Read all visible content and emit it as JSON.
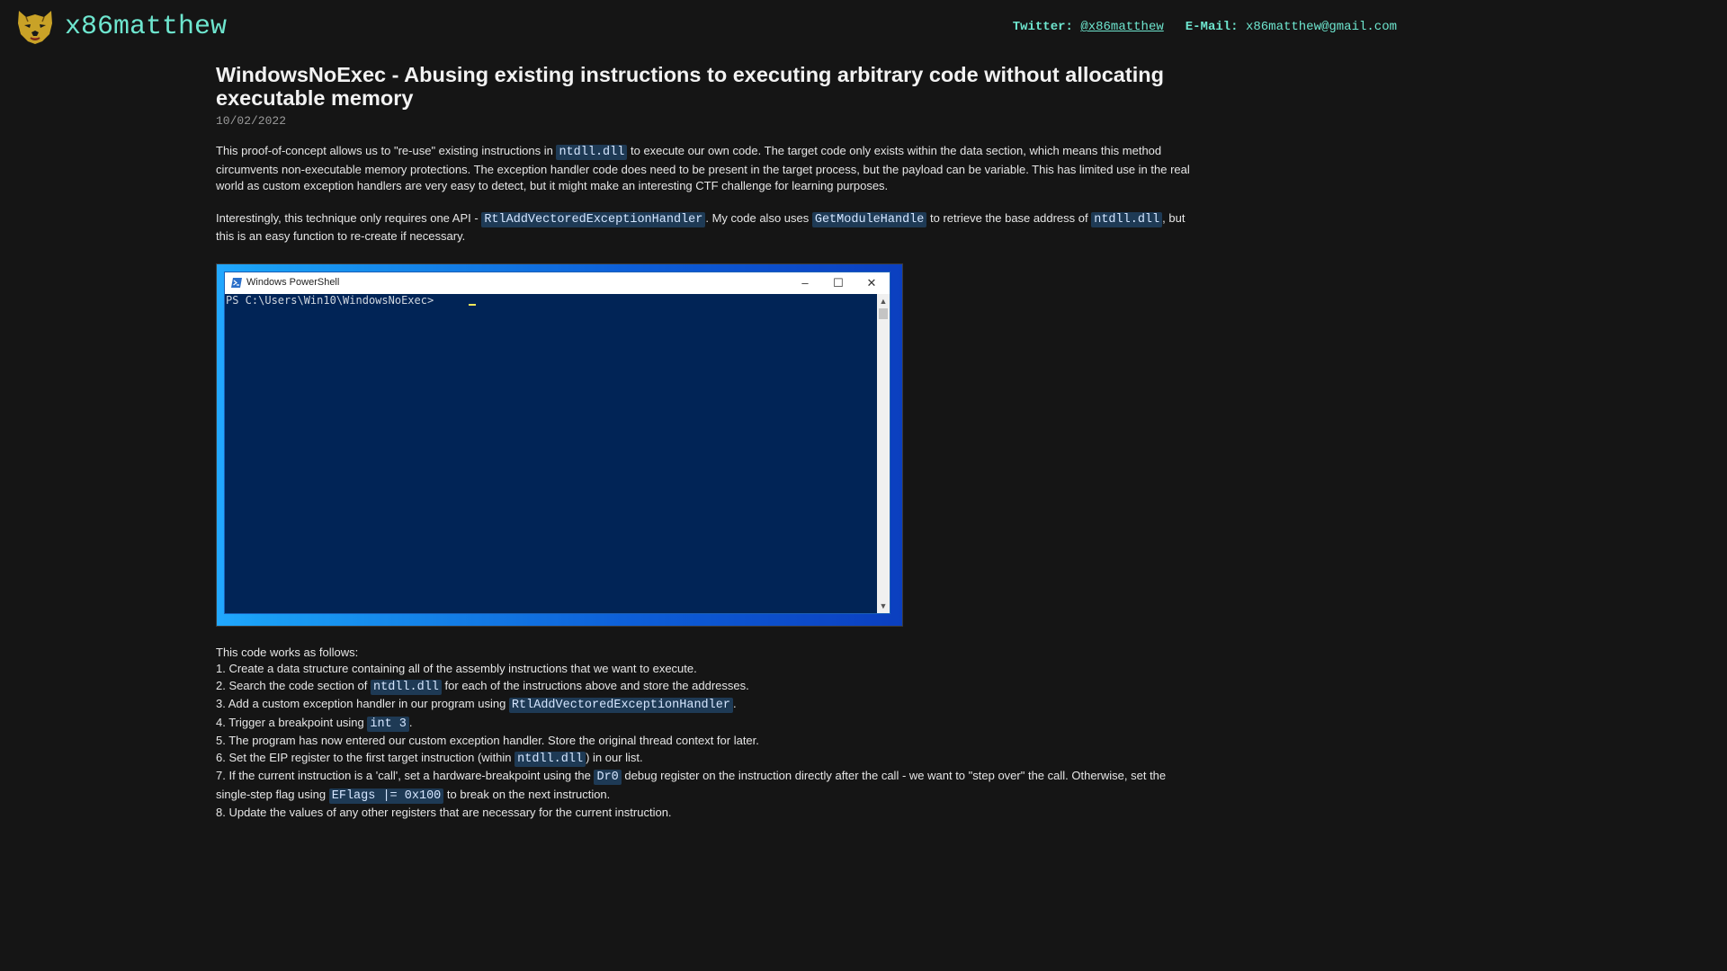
{
  "header": {
    "site_title": "x86matthew",
    "twitter_label": "Twitter:",
    "twitter_handle": "@x86matthew",
    "email_label": "E-Mail:",
    "email": "x86matthew@gmail.com"
  },
  "article": {
    "title": "WindowsNoExec - Abusing existing instructions to executing arbitrary code without allocating executable memory",
    "date": "10/02/2022",
    "p1": {
      "a": "This proof-of-concept allows us to \"re-use\" existing instructions in ",
      "code1": "ntdll.dll",
      "b": " to execute our own code. The target code only exists within the data section, which means this method circumvents non-executable memory protections. The exception handler code does need to be present in the target process, but the payload can be variable. This has limited use in the real world as custom exception handlers are very easy to detect, but it might make an interesting CTF challenge for learning purposes."
    },
    "p2": {
      "a": "Interestingly, this technique only requires one API - ",
      "code1": "RtlAddVectoredExceptionHandler",
      "b": ". My code also uses ",
      "code2": "GetModuleHandle",
      "c": " to retrieve the base address of ",
      "code3": "ntdll.dll",
      "d": ", but this is an easy function to re-create if necessary."
    },
    "screenshot": {
      "window_title": "Windows PowerShell",
      "prompt": "PS C:\\Users\\Win10\\WindowsNoExec> ",
      "minimize": "–",
      "maximize": "☐",
      "close": "✕"
    },
    "steps_intro": "This code works as follows:",
    "steps": {
      "s1": "1. Create a data structure containing all of the assembly instructions that we want to execute.",
      "s2a": "2. Search the code section of ",
      "s2code": "ntdll.dll",
      "s2b": " for each of the instructions above and store the addresses.",
      "s3a": "3. Add a custom exception handler in our program using ",
      "s3code": "RtlAddVectoredExceptionHandler",
      "s3b": ".",
      "s4a": "4. Trigger a breakpoint using ",
      "s4code": "int 3",
      "s4b": ".",
      "s5": "5. The program has now entered our custom exception handler. Store the original thread context for later.",
      "s6a": "6. Set the EIP register to the first target instruction (within ",
      "s6code": "ntdll.dll",
      "s6b": ") in our list.",
      "s7a": "7. If the current instruction is a 'call', set a hardware-breakpoint using the ",
      "s7code1": "Dr0",
      "s7b": " debug register on the instruction directly after the call - we want to \"step over\" the call. Otherwise, set the single-step flag using ",
      "s7code2": "EFlags |= 0x100",
      "s7c": " to break on the next instruction.",
      "s8": "8. Update the values of any other registers that are necessary for the current instruction."
    }
  }
}
